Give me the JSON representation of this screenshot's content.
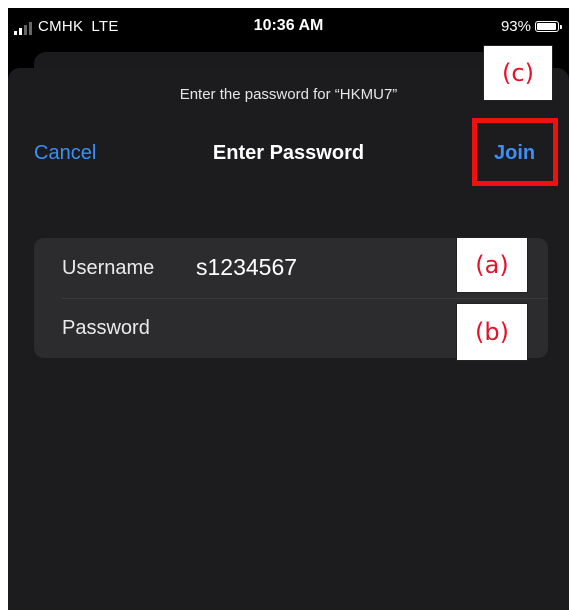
{
  "status_bar": {
    "carrier": "CMHK",
    "network": "LTE",
    "time": "10:36 AM",
    "battery_percent": "93%",
    "battery_level": 0.93
  },
  "dialog": {
    "prompt": "Enter the password for “HKMU7”",
    "title": "Enter Password",
    "cancel_label": "Cancel",
    "join_label": "Join"
  },
  "form": {
    "username_label": "Username",
    "username_value": "s1234567",
    "password_label": "Password",
    "password_value": ""
  },
  "annotations": {
    "a": "(a)",
    "b": "(b)",
    "c": "(c)",
    "color": "#e8102a"
  },
  "colors": {
    "accent_blue": "#3b8ff5",
    "highlight_red": "#ee1111",
    "sheet_bg": "#1c1c1e"
  }
}
